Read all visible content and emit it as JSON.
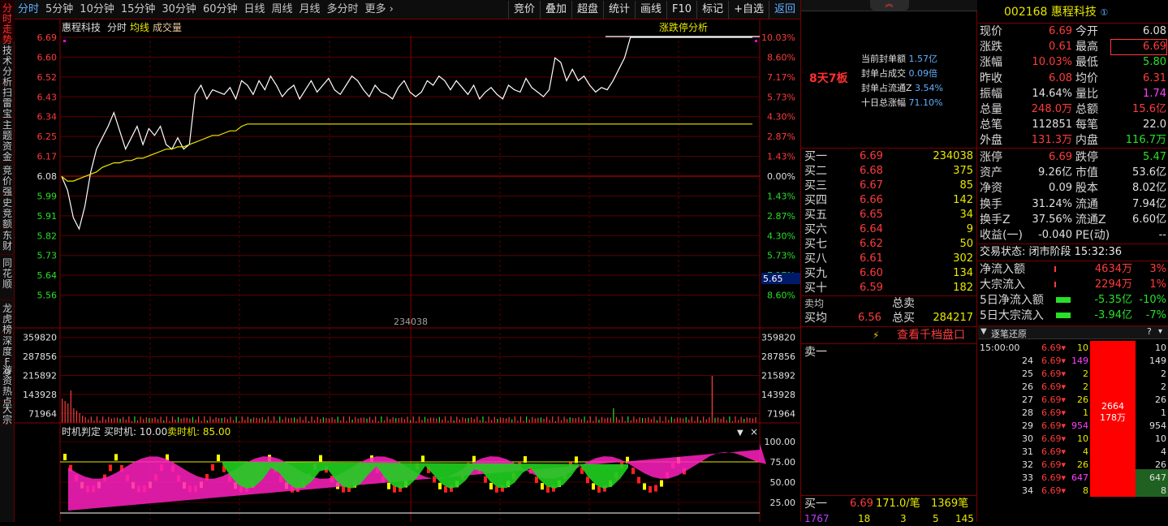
{
  "sidebar": [
    "分时走势",
    "技术分析",
    "扫雷宝",
    "主题资金",
    "竞价强",
    "史竞额",
    "东财",
    "同花顺",
    "龙虎榜",
    "深度F9",
    "游资热点",
    "大宗"
  ],
  "topbar": {
    "left": [
      "分时",
      "5分钟",
      "10分钟",
      "15分钟",
      "30分钟",
      "60分钟",
      "日线",
      "周线",
      "月线",
      "多分时",
      "更多 ›"
    ],
    "right": [
      "竞价",
      "叠加",
      "超盘",
      "统计",
      "画线",
      "F10",
      "标记",
      "+自选",
      "返回"
    ]
  },
  "chart": {
    "header": {
      "name": "惠程科技",
      "tab_fenshi": "分时",
      "tab_junxian": "均线",
      "tab_vol": "成交量",
      "limit_btn": "涨跌停分析"
    },
    "price_labels": [
      "6.69",
      "6.60",
      "6.52",
      "6.43",
      "6.34",
      "6.25",
      "6.17",
      "6.08",
      "5.99",
      "5.91",
      "5.82",
      "5.73",
      "5.64",
      "5.56"
    ],
    "pct_labels": [
      "10.03%",
      "8.60%",
      "7.17%",
      "5.73%",
      "4.30%",
      "2.87%",
      "1.43%",
      "0.00%",
      "1.43%",
      "2.87%",
      "4.30%",
      "5.73%",
      "7.17%",
      "8.60%"
    ],
    "cursor_price": "5.65",
    "vol_labels": [
      "359820",
      "287856",
      "215892",
      "143928",
      "71964"
    ],
    "vol_peak": "234038",
    "ind_header": {
      "name": "时机判定",
      "buy": "买时机: 10.00",
      "sell": "卖时机: 85.00"
    },
    "ind_labels": [
      "100.00",
      "75.00",
      "50.00",
      "25.00"
    ]
  },
  "chart_data": {
    "type": "line",
    "title": "惠程科技",
    "ylim": [
      5.47,
      6.69
    ],
    "prev_close": 6.08,
    "price": [
      6.08,
      6.02,
      5.9,
      5.85,
      5.95,
      6.1,
      6.2,
      6.25,
      6.3,
      6.36,
      6.28,
      6.2,
      6.25,
      6.3,
      6.22,
      6.29,
      6.26,
      6.3,
      6.22,
      6.2,
      6.25,
      6.2,
      6.22,
      6.44,
      6.48,
      6.42,
      6.46,
      6.45,
      6.44,
      6.47,
      6.42,
      6.5,
      6.48,
      6.44,
      6.5,
      6.46,
      6.52,
      6.48,
      6.43,
      6.46,
      6.48,
      6.42,
      6.46,
      6.5,
      6.45,
      6.48,
      6.51,
      6.46,
      6.44,
      6.48,
      6.52,
      6.5,
      6.46,
      6.43,
      6.48,
      6.45,
      6.44,
      6.42,
      6.47,
      6.5,
      6.45,
      6.43,
      6.45,
      6.5,
      6.48,
      6.52,
      6.5,
      6.46,
      6.5,
      6.47,
      6.44,
      6.48,
      6.42,
      6.45,
      6.47,
      6.44,
      6.42,
      6.48,
      6.46,
      6.45,
      6.51,
      6.47,
      6.45,
      6.43,
      6.46,
      6.6,
      6.58,
      6.5,
      6.55,
      6.5,
      6.52,
      6.48,
      6.45,
      6.47,
      6.46,
      6.5,
      6.55,
      6.6,
      6.69,
      6.69,
      6.69,
      6.69,
      6.69,
      6.69,
      6.69,
      6.69,
      6.69,
      6.69,
      6.69,
      6.69,
      6.69,
      6.69,
      6.69,
      6.69,
      6.69,
      6.69,
      6.69,
      6.69,
      6.69,
      6.69
    ],
    "avg": [
      6.08,
      6.06,
      6.06,
      6.07,
      6.08,
      6.09,
      6.1,
      6.12,
      6.13,
      6.14,
      6.14,
      6.15,
      6.15,
      6.16,
      6.16,
      6.17,
      6.18,
      6.19,
      6.2,
      6.2,
      6.21,
      6.21,
      6.22,
      6.23,
      6.24,
      6.25,
      6.26,
      6.26,
      6.27,
      6.28,
      6.28,
      6.3,
      6.31,
      6.31,
      6.31,
      6.31,
      6.31,
      6.31,
      6.31,
      6.31,
      6.31,
      6.31,
      6.31,
      6.31,
      6.31,
      6.31,
      6.31,
      6.31,
      6.31,
      6.31,
      6.31,
      6.31,
      6.31,
      6.31,
      6.31,
      6.31,
      6.31,
      6.31,
      6.31,
      6.31,
      6.31,
      6.31,
      6.31,
      6.31,
      6.31,
      6.31,
      6.31,
      6.31,
      6.31,
      6.31,
      6.31,
      6.31,
      6.31,
      6.31,
      6.31,
      6.31,
      6.31,
      6.31,
      6.31,
      6.31,
      6.31,
      6.31,
      6.31,
      6.31,
      6.31,
      6.31,
      6.31,
      6.31,
      6.31,
      6.31,
      6.31,
      6.31,
      6.31,
      6.31,
      6.31,
      6.31,
      6.31,
      6.31,
      6.31,
      6.31,
      6.31,
      6.31,
      6.31,
      6.31,
      6.31,
      6.31,
      6.31,
      6.31,
      6.31,
      6.31,
      6.31,
      6.31,
      6.31,
      6.31,
      6.31,
      6.31,
      6.31,
      6.31,
      6.31,
      6.31
    ]
  },
  "mid": {
    "ban": "8天7板",
    "stats": [
      {
        "k": "当前封单额",
        "v": "1.57亿"
      },
      {
        "k": "封单占成交",
        "v": "0.09倍"
      },
      {
        "k": "封单占流通Z",
        "v": "3.54%"
      },
      {
        "k": "十日总涨幅",
        "v": "71.10%"
      }
    ],
    "bids": [
      {
        "l": "买一",
        "p": "6.69",
        "v": "234038"
      },
      {
        "l": "买二",
        "p": "6.68",
        "v": "375"
      },
      {
        "l": "买三",
        "p": "6.67",
        "v": "85"
      },
      {
        "l": "买四",
        "p": "6.66",
        "v": "142"
      },
      {
        "l": "买五",
        "p": "6.65",
        "v": "34"
      },
      {
        "l": "买六",
        "p": "6.64",
        "v": "9"
      },
      {
        "l": "买七",
        "p": "6.62",
        "v": "50"
      },
      {
        "l": "买八",
        "p": "6.61",
        "v": "302"
      },
      {
        "l": "买九",
        "p": "6.60",
        "v": "134"
      },
      {
        "l": "买十",
        "p": "6.59",
        "v": "182"
      }
    ],
    "sell_avg": "卖均",
    "buy_avg": "买均",
    "buy_avg_val": "6.56",
    "total_sell": "总卖",
    "total_buy": "总买",
    "total_buy_val": "284217",
    "qianduan": "查看千档盘口",
    "sell1": "卖一",
    "buy1_bottom": {
      "l": "买一",
      "p": "6.69",
      "q": "171.0/笔",
      "n": "1369笔"
    },
    "bottom_row": [
      "1767",
      "18",
      "3",
      "5",
      "145"
    ]
  },
  "right": {
    "code": "002168",
    "name": "惠程科技",
    "quote": [
      [
        "现价",
        "6.69",
        "今开",
        "6.08"
      ],
      [
        "涨跌",
        "0.61",
        "最高",
        "6.69"
      ],
      [
        "涨幅",
        "10.03%",
        "最低",
        "5.80"
      ],
      [
        "昨收",
        "6.08",
        "均价",
        "6.31"
      ],
      [
        "振幅",
        "14.64%",
        "量比",
        "1.74"
      ],
      [
        "总量",
        "248.0万",
        "总额",
        "15.6亿"
      ],
      [
        "总笔",
        "112851",
        "每笔",
        "22.0"
      ],
      [
        "外盘",
        "131.3万",
        "内盘",
        "116.7万"
      ]
    ],
    "limits": [
      [
        "涨停",
        "6.69",
        "跌停",
        "5.47"
      ],
      [
        "资产",
        "9.26亿",
        "市值",
        "53.6亿"
      ],
      [
        "净资",
        "0.09",
        "股本",
        "8.02亿"
      ],
      [
        "换手",
        "31.24%",
        "流通",
        "7.94亿"
      ],
      [
        "换手Z",
        "37.56%",
        "流通Z",
        "6.60亿"
      ],
      [
        "收益(一)",
        "-0.040",
        "PE(动)",
        "--"
      ]
    ],
    "trade_state": "交易状态: 闭市阶段 15:32:36",
    "flows": [
      {
        "k": "净流入额",
        "v": "4634万",
        "p": "3%"
      },
      {
        "k": "大宗流入",
        "v": "2294万",
        "p": "1%"
      },
      {
        "k": "5日净流入额",
        "v": "-5.35亿",
        "p": "-10%"
      },
      {
        "k": "5日大宗流入",
        "v": "-3.94亿",
        "p": "-7%"
      }
    ],
    "tick_title": "逐笔还原",
    "ticks": [
      {
        "t": "15:00:00",
        "p": "6.69",
        "v": "10",
        "r": "10"
      },
      {
        "t": "24",
        "p": "6.69",
        "v": "149",
        "r": "149"
      },
      {
        "t": "25",
        "p": "6.69",
        "v": "2",
        "r": "2"
      },
      {
        "t": "26",
        "p": "6.69",
        "v": "2",
        "r": "2"
      },
      {
        "t": "27",
        "p": "6.69",
        "v": "26",
        "r": "26"
      },
      {
        "t": "28",
        "p": "6.69",
        "v": "1",
        "r": "1"
      },
      {
        "t": "29",
        "p": "6.69",
        "v": "954",
        "r": "954"
      },
      {
        "t": "30",
        "p": "6.69",
        "v": "10",
        "r": "10"
      },
      {
        "t": "31",
        "p": "6.69",
        "v": "4",
        "r": "4"
      },
      {
        "t": "32",
        "p": "6.69",
        "v": "26",
        "r": "26"
      },
      {
        "t": "33",
        "p": "6.69",
        "v": "647",
        "r": "647"
      },
      {
        "t": "34",
        "p": "6.69",
        "v": "8",
        "r": "8"
      }
    ],
    "tick_summary": [
      "2664",
      "178万"
    ]
  }
}
